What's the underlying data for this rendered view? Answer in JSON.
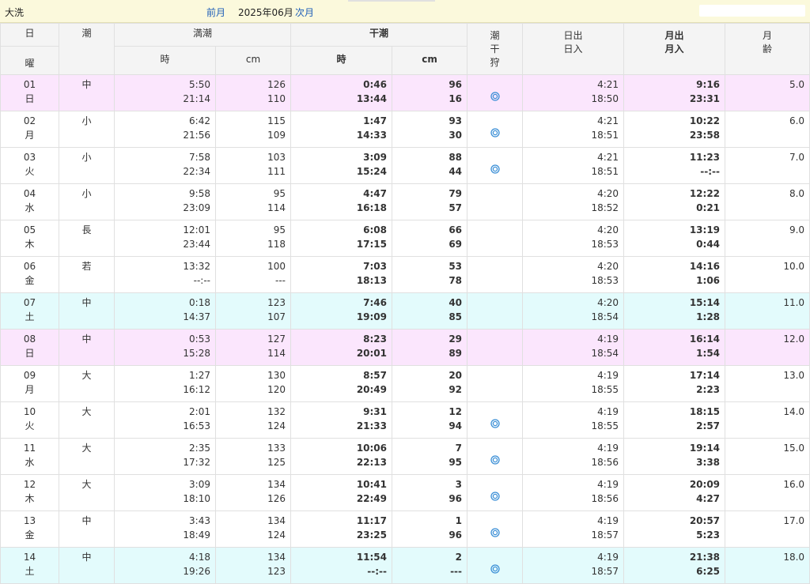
{
  "header": {
    "location": "大洗",
    "prev_label": "前月",
    "month_label": "2025年06月",
    "next_label": "次月"
  },
  "columns": {
    "day": "日",
    "weekday": "曜",
    "tide_type": "潮",
    "high_tide": "満潮",
    "low_tide": "干潮",
    "time": "時",
    "cm": "cm",
    "shiohigari": [
      "潮",
      "干",
      "狩"
    ],
    "sun": [
      "日出",
      "日入"
    ],
    "moon": [
      "月出",
      "月入"
    ],
    "moon_age": [
      "月",
      "齢"
    ]
  },
  "colors": {
    "weekend_sunday": "#fbe6fd",
    "weekend_saturday": "#e3fbfc",
    "link": "#1f5fb8",
    "mark": "#3b8fd6"
  },
  "rows": [
    {
      "day": "01",
      "wd": "日",
      "tide": "中",
      "h1": "5:50",
      "h2": "21:14",
      "hc1": "126",
      "hc2": "110",
      "l1": "0:46",
      "l2": "13:44",
      "lc1": "96",
      "lc2": "16",
      "mark": true,
      "sr": "4:21",
      "ss": "18:50",
      "mr": "9:16",
      "ms": "23:31",
      "age": "5.0",
      "bg": "pink"
    },
    {
      "day": "02",
      "wd": "月",
      "tide": "小",
      "h1": "6:42",
      "h2": "21:56",
      "hc1": "115",
      "hc2": "109",
      "l1": "1:47",
      "l2": "14:33",
      "lc1": "93",
      "lc2": "30",
      "mark": true,
      "sr": "4:21",
      "ss": "18:51",
      "mr": "10:22",
      "ms": "23:58",
      "age": "6.0",
      "bg": ""
    },
    {
      "day": "03",
      "wd": "火",
      "tide": "小",
      "h1": "7:58",
      "h2": "22:34",
      "hc1": "103",
      "hc2": "111",
      "l1": "3:09",
      "l2": "15:24",
      "lc1": "88",
      "lc2": "44",
      "mark": true,
      "sr": "4:21",
      "ss": "18:51",
      "mr": "11:23",
      "ms": "--:--",
      "age": "7.0",
      "bg": ""
    },
    {
      "day": "04",
      "wd": "水",
      "tide": "小",
      "h1": "9:58",
      "h2": "23:09",
      "hc1": "95",
      "hc2": "114",
      "l1": "4:47",
      "l2": "16:18",
      "lc1": "79",
      "lc2": "57",
      "mark": false,
      "sr": "4:20",
      "ss": "18:52",
      "mr": "12:22",
      "ms": "0:21",
      "age": "8.0",
      "bg": ""
    },
    {
      "day": "05",
      "wd": "木",
      "tide": "長",
      "h1": "12:01",
      "h2": "23:44",
      "hc1": "95",
      "hc2": "118",
      "l1": "6:08",
      "l2": "17:15",
      "lc1": "66",
      "lc2": "69",
      "mark": false,
      "sr": "4:20",
      "ss": "18:53",
      "mr": "13:19",
      "ms": "0:44",
      "age": "9.0",
      "bg": ""
    },
    {
      "day": "06",
      "wd": "金",
      "tide": "若",
      "h1": "13:32",
      "h2": "--:--",
      "hc1": "100",
      "hc2": "---",
      "l1": "7:03",
      "l2": "18:13",
      "lc1": "53",
      "lc2": "78",
      "mark": false,
      "sr": "4:20",
      "ss": "18:53",
      "mr": "14:16",
      "ms": "1:06",
      "age": "10.0",
      "bg": ""
    },
    {
      "day": "07",
      "wd": "土",
      "tide": "中",
      "h1": "0:18",
      "h2": "14:37",
      "hc1": "123",
      "hc2": "107",
      "l1": "7:46",
      "l2": "19:09",
      "lc1": "40",
      "lc2": "85",
      "mark": false,
      "sr": "4:20",
      "ss": "18:54",
      "mr": "15:14",
      "ms": "1:28",
      "age": "11.0",
      "bg": "cyan"
    },
    {
      "day": "08",
      "wd": "日",
      "tide": "中",
      "h1": "0:53",
      "h2": "15:28",
      "hc1": "127",
      "hc2": "114",
      "l1": "8:23",
      "l2": "20:01",
      "lc1": "29",
      "lc2": "89",
      "mark": false,
      "sr": "4:19",
      "ss": "18:54",
      "mr": "16:14",
      "ms": "1:54",
      "age": "12.0",
      "bg": "pink"
    },
    {
      "day": "09",
      "wd": "月",
      "tide": "大",
      "h1": "1:27",
      "h2": "16:12",
      "hc1": "130",
      "hc2": "120",
      "l1": "8:57",
      "l2": "20:49",
      "lc1": "20",
      "lc2": "92",
      "mark": false,
      "sr": "4:19",
      "ss": "18:55",
      "mr": "17:14",
      "ms": "2:23",
      "age": "13.0",
      "bg": ""
    },
    {
      "day": "10",
      "wd": "火",
      "tide": "大",
      "h1": "2:01",
      "h2": "16:53",
      "hc1": "132",
      "hc2": "124",
      "l1": "9:31",
      "l2": "21:33",
      "lc1": "12",
      "lc2": "94",
      "mark": true,
      "sr": "4:19",
      "ss": "18:55",
      "mr": "18:15",
      "ms": "2:57",
      "age": "14.0",
      "bg": ""
    },
    {
      "day": "11",
      "wd": "水",
      "tide": "大",
      "h1": "2:35",
      "h2": "17:32",
      "hc1": "133",
      "hc2": "125",
      "l1": "10:06",
      "l2": "22:13",
      "lc1": "7",
      "lc2": "95",
      "mark": true,
      "sr": "4:19",
      "ss": "18:56",
      "mr": "19:14",
      "ms": "3:38",
      "age": "15.0",
      "bg": ""
    },
    {
      "day": "12",
      "wd": "木",
      "tide": "大",
      "h1": "3:09",
      "h2": "18:10",
      "hc1": "134",
      "hc2": "126",
      "l1": "10:41",
      "l2": "22:49",
      "lc1": "3",
      "lc2": "96",
      "mark": true,
      "sr": "4:19",
      "ss": "18:56",
      "mr": "20:09",
      "ms": "4:27",
      "age": "16.0",
      "bg": ""
    },
    {
      "day": "13",
      "wd": "金",
      "tide": "中",
      "h1": "3:43",
      "h2": "18:49",
      "hc1": "134",
      "hc2": "124",
      "l1": "11:17",
      "l2": "23:25",
      "lc1": "1",
      "lc2": "96",
      "mark": true,
      "sr": "4:19",
      "ss": "18:57",
      "mr": "20:57",
      "ms": "5:23",
      "age": "17.0",
      "bg": ""
    },
    {
      "day": "14",
      "wd": "土",
      "tide": "中",
      "h1": "4:18",
      "h2": "19:26",
      "hc1": "134",
      "hc2": "123",
      "l1": "11:54",
      "l2": "--:--",
      "lc1": "2",
      "lc2": "---",
      "mark": true,
      "sr": "4:19",
      "ss": "18:57",
      "mr": "21:38",
      "ms": "6:25",
      "age": "18.0",
      "bg": "cyan"
    }
  ]
}
